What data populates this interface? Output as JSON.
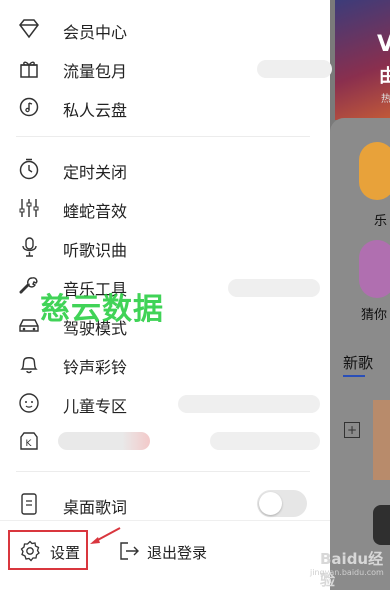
{
  "menu": {
    "items": [
      {
        "label": "会员中心",
        "icon": "diamond-icon"
      },
      {
        "label": "流量包月",
        "icon": "gift-icon"
      },
      {
        "label": "私人云盘",
        "icon": "cloud-music-icon"
      },
      {
        "label": "定时关闭",
        "icon": "timer-icon"
      },
      {
        "label": "蝰蛇音效",
        "icon": "equalizer-icon"
      },
      {
        "label": "听歌识曲",
        "icon": "mic-recognize-icon"
      },
      {
        "label": "音乐工具",
        "icon": "wrench-icon"
      },
      {
        "label": "驾驶模式",
        "icon": "car-icon"
      },
      {
        "label": "铃声彩铃",
        "icon": "bell-icon"
      },
      {
        "label": "儿童专区",
        "icon": "kid-face-icon"
      },
      {
        "label": "",
        "icon": "k-song-icon"
      },
      {
        "label": "桌面歌词",
        "icon": "phone-lyrics-icon"
      }
    ],
    "desktop_lyrics_enabled": false
  },
  "bottom": {
    "settings_label": "设置",
    "logout_label": "退出登录"
  },
  "background": {
    "banner_letter": "V",
    "banner_char": "由",
    "banner_sub": "热",
    "card1_label": "乐",
    "card2_label": "猜你",
    "tab_label": "新歌",
    "plus": "+"
  },
  "watermark": {
    "text": "慈云数据",
    "baidu": "Baidu经验",
    "baidu_sub": "jingyan.baidu.com"
  },
  "colors": {
    "highlight_border": "#d9363e",
    "watermark_green": "#1fcc3a"
  }
}
